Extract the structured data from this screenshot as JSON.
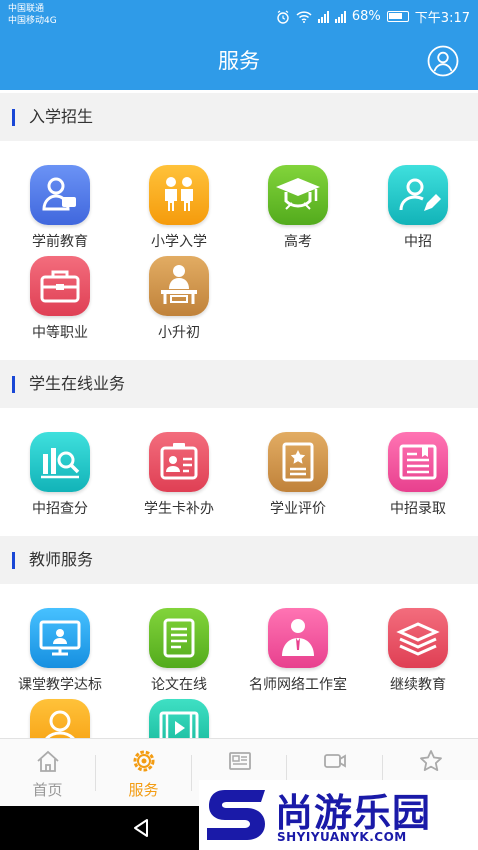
{
  "status_bar": {
    "carrier_1": "中国联通",
    "carrier_2": "中国移动4G",
    "battery": "68%",
    "time": "下午3:17"
  },
  "header": {
    "title": "服务",
    "user_icon": "user-circle-icon"
  },
  "sections": [
    {
      "title": "入学招生",
      "items": [
        {
          "label": "学前教育",
          "icon": "preschool-child-icon",
          "color": "#4f79ea"
        },
        {
          "label": "小学入学",
          "icon": "pupils-icon",
          "color": "#f9a719"
        },
        {
          "label": "高考",
          "icon": "graduation-cap-icon",
          "color": "#67bf2b"
        },
        {
          "label": "中招",
          "icon": "user-edit-icon",
          "color": "#1bc6c8"
        },
        {
          "label": "中等职业",
          "icon": "briefcase-icon",
          "color": "#e95163"
        },
        {
          "label": "小升初",
          "icon": "student-desk-icon",
          "color": "#cf9448"
        }
      ]
    },
    {
      "title": "学生在线业务",
      "items": [
        {
          "label": "中招查分",
          "icon": "score-search-icon",
          "color": "#1bc6c8"
        },
        {
          "label": "学生卡补办",
          "icon": "student-card-icon",
          "color": "#e95163"
        },
        {
          "label": "学业评价",
          "icon": "evaluation-certificate-icon",
          "color": "#cf9448"
        },
        {
          "label": "中招录取",
          "icon": "admission-document-icon",
          "color": "#ef4f9a"
        }
      ]
    },
    {
      "title": "教师服务",
      "items": [
        {
          "label": "课堂教学达标",
          "icon": "classroom-screen-icon",
          "color": "#1fa9ee"
        },
        {
          "label": "论文在线",
          "icon": "paper-document-icon",
          "color": "#67bf2b"
        },
        {
          "label": "名师网络工作室",
          "icon": "teacher-icon",
          "color": "#ef4f9a"
        },
        {
          "label": "继续教育",
          "icon": "books-stack-icon",
          "color": "#e95163"
        },
        {
          "label": "",
          "icon": "person-portrait-icon",
          "color": "#f9a719"
        },
        {
          "label": "",
          "icon": "video-film-icon",
          "color": "#1bc6a8"
        }
      ]
    }
  ],
  "bottom_nav": [
    {
      "label": "首页",
      "icon": "home-icon",
      "active": false
    },
    {
      "label": "服务",
      "icon": "service-gear-icon",
      "active": true
    },
    {
      "label": "",
      "icon": "news-icon",
      "active": false
    },
    {
      "label": "",
      "icon": "video-camera-icon",
      "active": false
    },
    {
      "label": "",
      "icon": "star-icon",
      "active": false
    }
  ],
  "watermark": {
    "text": "尚游乐园",
    "subtext": "SHYIYUANYK.COM"
  },
  "colors": {
    "primary": "#2f9be8",
    "accent": "#f39c12",
    "section_marker": "#1947d6"
  }
}
